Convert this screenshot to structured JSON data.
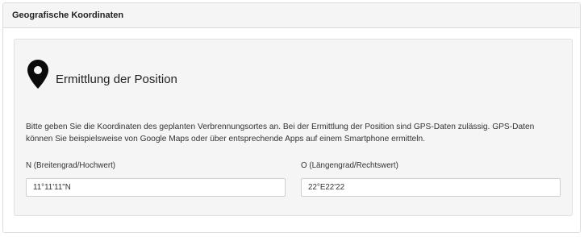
{
  "panel": {
    "title": "Geografische Koordinaten"
  },
  "section": {
    "icon": "map-marker-icon",
    "title": "Ermittlung der Position",
    "description": "Bitte geben Sie die Koordinaten des geplanten Verbrennungsortes an. Bei der Ermittlung der Position sind GPS-Daten zulässig. GPS-Daten können Sie beispielsweise von Google Maps oder über entsprechende Apps auf einem Smartphone ermitteln."
  },
  "fields": {
    "north": {
      "label": "N (Breitengrad/Hochwert)",
      "value": "11°11'11\"N"
    },
    "east": {
      "label": "O (Längengrad/Rechtswert)",
      "value": "22°E22'22"
    }
  },
  "colors": {
    "header_bg": "#f5f5f5",
    "well_bg": "#f5f5f5",
    "border": "#dcdcdc",
    "text": "#222222"
  }
}
